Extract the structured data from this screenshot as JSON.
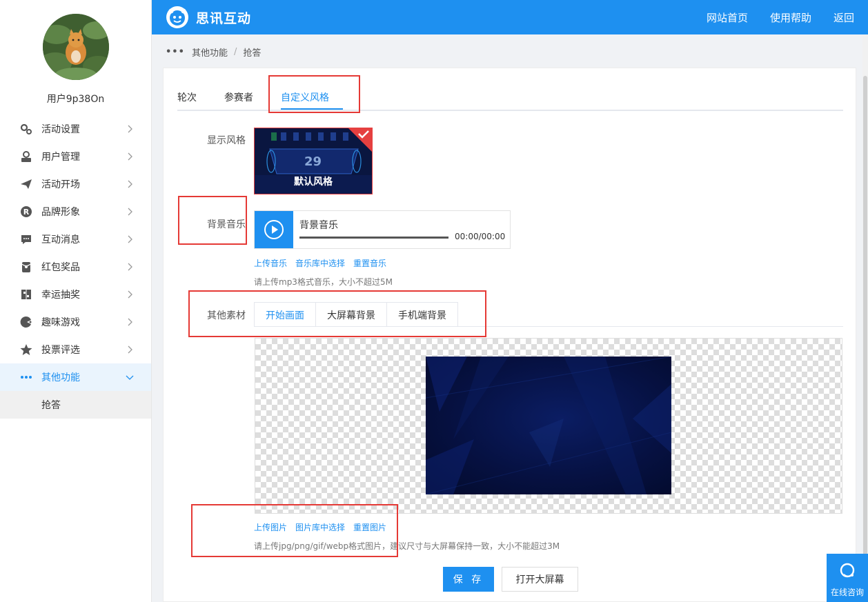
{
  "brand": {
    "name": "思讯互动",
    "primary_color": "#1e90f0",
    "accent_red": "#e53935"
  },
  "user": {
    "name": "用户9p38On"
  },
  "sidebar": {
    "items": [
      {
        "label": "活动设置",
        "icon": "gears-icon"
      },
      {
        "label": "用户管理",
        "icon": "user-manage-icon"
      },
      {
        "label": "活动开场",
        "icon": "paper-plane-icon"
      },
      {
        "label": "品牌形象",
        "icon": "registered-icon"
      },
      {
        "label": "互动消息",
        "icon": "chat-bubble-icon"
      },
      {
        "label": "红包奖品",
        "icon": "red-packet-icon"
      },
      {
        "label": "幸运抽奖",
        "icon": "lottery-icon"
      },
      {
        "label": "趣味游戏",
        "icon": "game-pad-icon"
      },
      {
        "label": "投票评选",
        "icon": "star-icon"
      },
      {
        "label": "其他功能",
        "icon": "more-dots-icon",
        "active": true
      }
    ],
    "sub_items": [
      {
        "label": "抢答"
      }
    ]
  },
  "header": {
    "nav": [
      {
        "label": "网站首页"
      },
      {
        "label": "使用帮助"
      },
      {
        "label": "返回"
      }
    ]
  },
  "breadcrumb": {
    "parent": "其他功能",
    "separator": "/",
    "current": "抢答"
  },
  "tabs": [
    {
      "label": "轮次"
    },
    {
      "label": "参赛者"
    },
    {
      "label": "自定义风格",
      "active": true
    }
  ],
  "display_style": {
    "label": "显示风格",
    "card_name": "默认风格",
    "card_number": "29"
  },
  "bg_music": {
    "label": "背景音乐",
    "title": "背景音乐",
    "time": "00:00/00:00",
    "links": [
      "上传音乐",
      "音乐库中选择",
      "重置音乐"
    ],
    "hint": "请上传mp3格式音乐，大小不超过5M"
  },
  "materials": {
    "label": "其他素材",
    "subtabs": [
      {
        "label": "开始画面",
        "active": true
      },
      {
        "label": "大屏幕背景"
      },
      {
        "label": "手机端背景"
      }
    ],
    "links": [
      "上传图片",
      "图片库中选择",
      "重置图片"
    ],
    "hint": "请上传jpg/png/gif/webp格式图片，建议尺寸与大屏幕保持一致，大小不能超过3M"
  },
  "actions": {
    "save": "保 存",
    "open_screen": "打开大屏幕"
  },
  "support": {
    "label": "在线咨询"
  }
}
